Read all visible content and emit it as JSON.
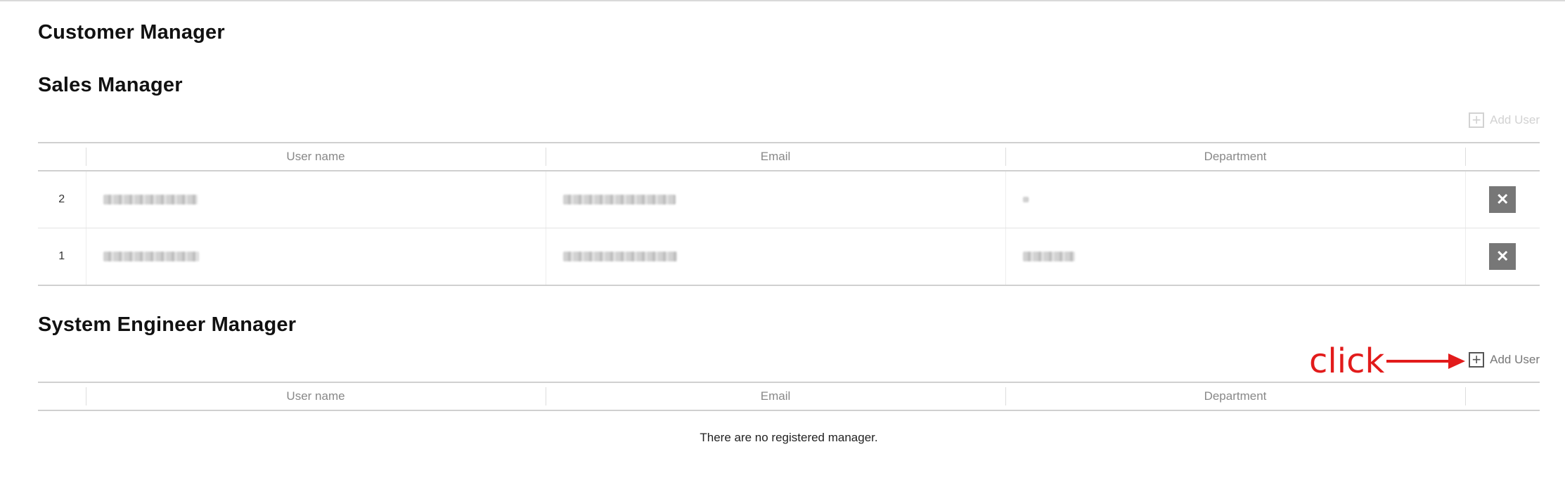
{
  "sections": {
    "customer_manager": {
      "title": "Customer Manager"
    },
    "sales_manager": {
      "title": "Sales Manager",
      "add_user_label": "Add User",
      "columns": [
        "User name",
        "Email",
        "Department"
      ],
      "rows": [
        {
          "no": "2",
          "user_name_redacted": true,
          "email_redacted": true,
          "department_redacted": true
        },
        {
          "no": "1",
          "user_name_redacted": true,
          "email_redacted": true,
          "department_redacted": true
        }
      ],
      "delete_icon": "close-icon"
    },
    "system_engineer_manager": {
      "title": "System Engineer Manager",
      "add_user_label": "Add User",
      "columns": [
        "User name",
        "Email",
        "Department"
      ],
      "empty_message": "There are no registered manager."
    }
  },
  "annotation": {
    "text": "click",
    "color": "#e21b1b"
  },
  "colors": {
    "delete_button": "#777777",
    "disabled_add": "#d2d2d2"
  }
}
